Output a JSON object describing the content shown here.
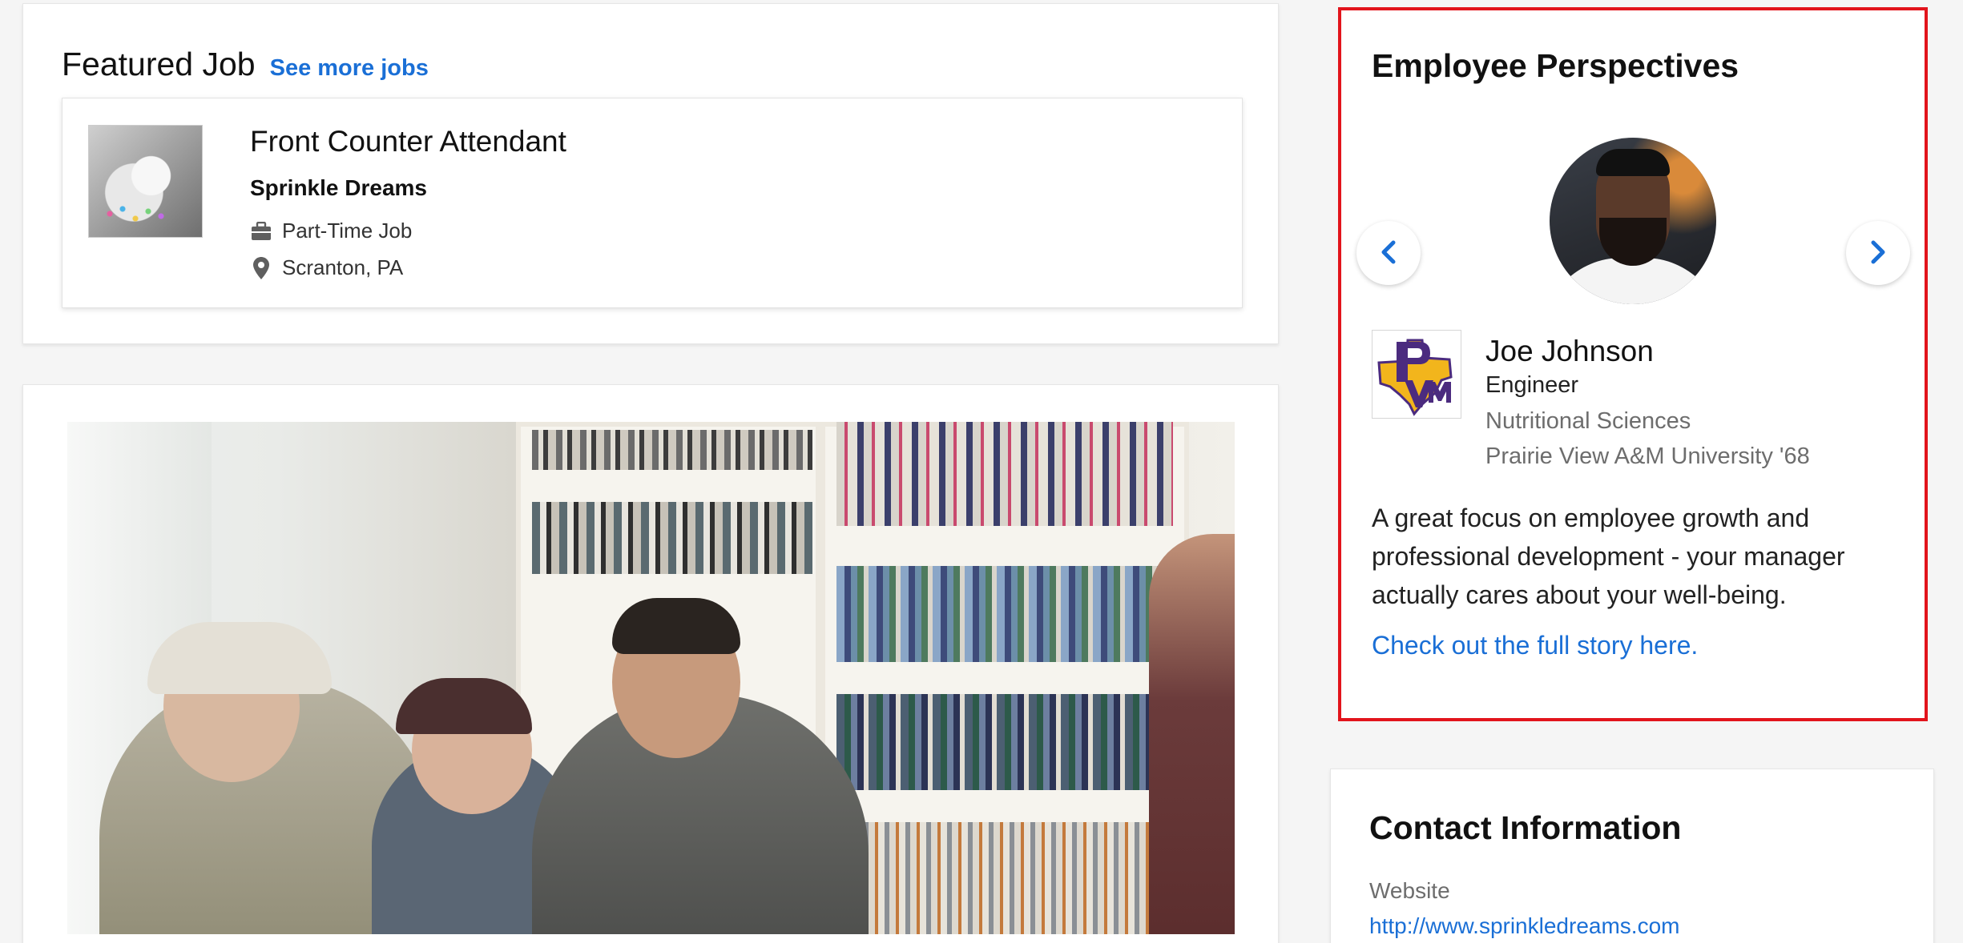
{
  "featured_job": {
    "heading": "Featured Job",
    "see_more_label": "See more jobs",
    "job": {
      "title": "Front Counter Attendant",
      "company": "Sprinkle Dreams",
      "type": "Part-Time Job",
      "location": "Scranton, PA",
      "type_icon": "briefcase-icon",
      "location_icon": "map-pin-icon"
    }
  },
  "employee_perspectives": {
    "heading": "Employee Perspectives",
    "prev_icon": "chevron-left-icon",
    "next_icon": "chevron-right-icon",
    "employee": {
      "name": "Joe Johnson",
      "role": "Engineer",
      "major": "Nutritional Sciences",
      "school": "Prairie View A&M University '68"
    },
    "quote": "A great focus on employee growth and professional development - your manager actually cares about your well-being.",
    "story_link": "Check out the full story here."
  },
  "contact": {
    "heading": "Contact Information",
    "website_label": "Website",
    "website_url": "http://www.sprinkledreams.com"
  },
  "colors": {
    "link": "#1a6fd6",
    "highlight_border": "#e2141c",
    "background": "#f5f5f5"
  }
}
